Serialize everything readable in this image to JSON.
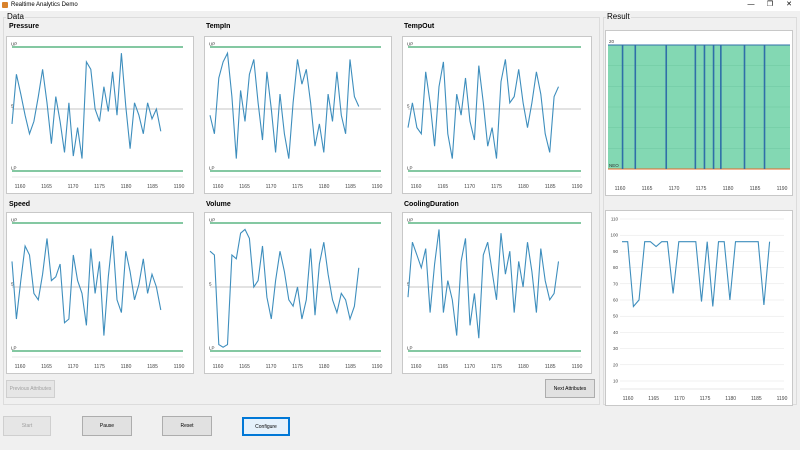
{
  "window": {
    "title": "Realtime Analytics Demo",
    "minimize_glyph": "—",
    "maximize_glyph": "❐",
    "close_glyph": "✕"
  },
  "data_group": {
    "label": "Data"
  },
  "result_group": {
    "label": "Result"
  },
  "colors": {
    "line": "#3e8ebd",
    "limit": "#3aa86a",
    "center": "#b0b0b0",
    "area": "#83d8b3",
    "area_edge": "#2f6fa8"
  },
  "x_ticks": [
    "1160",
    "1165",
    "1170",
    "1175",
    "1180",
    "1185",
    "1190"
  ],
  "charts": [
    {
      "title": "Pressure",
      "ucl_label": "UP",
      "center_label": "5",
      "lcl_label": "LP",
      "values": [
        0.38,
        0.78,
        0.62,
        0.45,
        0.3,
        0.4,
        0.6,
        0.82,
        0.55,
        0.22,
        0.6,
        0.4,
        0.15,
        0.55,
        0.12,
        0.35,
        0.1,
        0.88,
        0.82,
        0.5,
        0.4,
        0.68,
        0.48,
        0.8,
        0.45,
        0.95,
        0.52,
        0.18,
        0.55,
        0.45,
        0.3,
        0.55,
        0.42,
        0.5,
        0.32
      ]
    },
    {
      "title": "TempIn",
      "ucl_label": "UP",
      "center_label": "",
      "lcl_label": "LP",
      "values": [
        0.45,
        0.3,
        0.75,
        0.88,
        0.95,
        0.6,
        0.1,
        0.65,
        0.4,
        0.78,
        0.9,
        0.55,
        0.25,
        0.8,
        0.5,
        0.15,
        0.62,
        0.3,
        0.1,
        0.55,
        0.9,
        0.7,
        0.82,
        0.55,
        0.2,
        0.38,
        0.15,
        0.62,
        0.4,
        0.8,
        0.45,
        0.3,
        0.9,
        0.6,
        0.52
      ]
    },
    {
      "title": "TempOut",
      "ucl_label": "UP",
      "center_label": "5",
      "lcl_label": "LP",
      "values": [
        0.35,
        0.55,
        0.35,
        0.3,
        0.8,
        0.55,
        0.2,
        0.68,
        0.88,
        0.3,
        0.1,
        0.62,
        0.45,
        0.75,
        0.4,
        0.25,
        0.85,
        0.55,
        0.2,
        0.35,
        0.1,
        0.72,
        0.9,
        0.55,
        0.6,
        0.82,
        0.55,
        0.35,
        0.55,
        0.8,
        0.62,
        0.3,
        0.15,
        0.6,
        0.68
      ]
    },
    {
      "title": "Speed",
      "ucl_label": "UP",
      "center_label": "5",
      "lcl_label": "LP",
      "values": [
        0.7,
        0.25,
        0.55,
        0.82,
        0.75,
        0.45,
        0.4,
        0.6,
        0.88,
        0.55,
        0.58,
        0.68,
        0.22,
        0.25,
        0.75,
        0.55,
        0.45,
        0.2,
        0.8,
        0.45,
        0.7,
        0.12,
        0.58,
        0.9,
        0.4,
        0.3,
        0.78,
        0.62,
        0.4,
        0.52,
        0.72,
        0.45,
        0.6,
        0.5,
        0.32
      ]
    },
    {
      "title": "Volume",
      "ucl_label": "UP",
      "center_label": "5",
      "lcl_label": "LP",
      "values": [
        0.78,
        0.75,
        0.05,
        0.03,
        0.05,
        0.75,
        0.72,
        0.92,
        0.95,
        0.88,
        0.5,
        0.55,
        0.82,
        0.42,
        0.25,
        0.55,
        0.78,
        0.62,
        0.4,
        0.35,
        0.5,
        0.25,
        0.4,
        0.8,
        0.28,
        0.68,
        0.85,
        0.6,
        0.4,
        0.3,
        0.45,
        0.4,
        0.25,
        0.35,
        0.65
      ]
    },
    {
      "title": "CoolingDuration",
      "ucl_label": "UP",
      "center_label": "5",
      "lcl_label": "LP",
      "values": [
        0.42,
        0.85,
        0.75,
        0.65,
        0.8,
        0.3,
        0.68,
        0.95,
        0.3,
        0.55,
        0.4,
        0.12,
        0.7,
        0.88,
        0.2,
        0.45,
        0.1,
        0.75,
        0.85,
        0.62,
        0.4,
        0.92,
        0.6,
        0.78,
        0.3,
        0.7,
        0.5,
        0.85,
        0.62,
        0.3,
        0.8,
        0.55,
        0.4,
        0.45,
        0.7
      ]
    }
  ],
  "result_top": {
    "y_top_label": "20",
    "y_bottom_label": "NEO",
    "spikes": [
      0.08,
      0.15,
      0.32,
      0.48,
      0.53,
      0.58,
      0.62,
      0.75,
      0.86
    ]
  },
  "result_bottom": {
    "y_ticks": [
      "110",
      "100",
      "90",
      "80",
      "70",
      "60",
      "50",
      "40",
      "30",
      "20",
      "10"
    ],
    "values": [
      96,
      96,
      56,
      60,
      96,
      96,
      93,
      96,
      96,
      64,
      96,
      96,
      96,
      96,
      59,
      96,
      56,
      96,
      96,
      60,
      96,
      96,
      96,
      96,
      96,
      57,
      96
    ]
  },
  "buttons": {
    "previous": "Previous Attributes",
    "next": "Next Attributes",
    "start": "Start",
    "pause": "Pause",
    "reset": "Reset",
    "configure": "Configure"
  }
}
